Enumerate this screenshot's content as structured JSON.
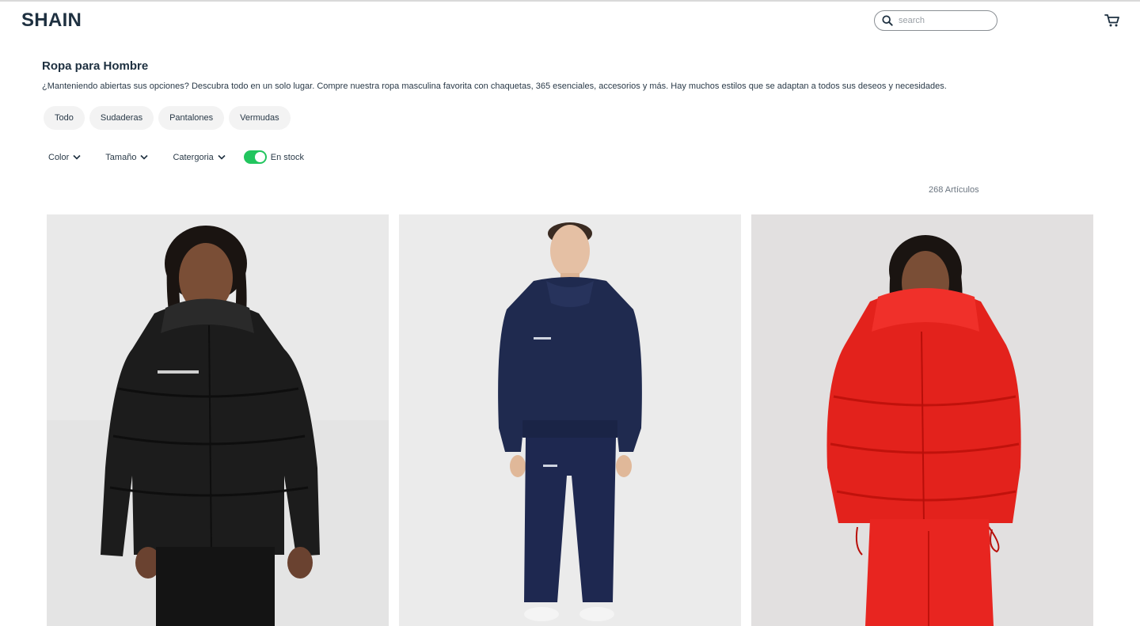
{
  "header": {
    "logo": "SHAIN",
    "search_placeholder": "search",
    "search_icon": "search-icon",
    "cart_icon": "cart-icon"
  },
  "page": {
    "title": "Ropa para Hombre",
    "description": "¿Manteniendo abiertas sus opciones? Descubra todo en un solo lugar. Compre nuestra ropa masculina favorita con chaquetas, 365 esenciales, accesorios y más. Hay muchos estilos que se adaptan a todos sus deseos y necesidades."
  },
  "categories": [
    "Todo",
    "Sudaderas",
    "Pantalones",
    "Vermudas"
  ],
  "filters": {
    "color": "Color",
    "size": "Tamaño",
    "category": "Catergoria",
    "in_stock_label": "En stock",
    "in_stock_on": true,
    "dropdown_icon": "chevron-down-icon"
  },
  "results": {
    "count_label": "268 Artículos"
  },
  "products": [
    {
      "image": "black-puffer-jacket",
      "color": "#1c1c1c"
    },
    {
      "image": "navy-hoodie-and-sweatpants",
      "color": "#1f2a4f"
    },
    {
      "image": "red-puffer-jacket",
      "color": "#e3221c"
    }
  ],
  "colors": {
    "brand": "#1e3040",
    "toggle_on": "#22c55e",
    "chip_bg": "#f3f3f3"
  }
}
